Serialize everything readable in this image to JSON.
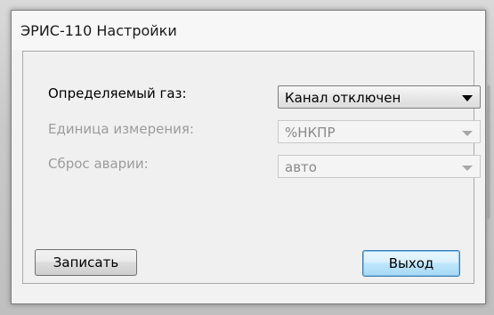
{
  "window": {
    "title": "ЭРИС-110 Настройки"
  },
  "settings": {
    "gas": {
      "label": "Определяемый газ:",
      "value": "Канал отключен",
      "enabled": true
    },
    "unit": {
      "label": "Единица измерения:",
      "value": "%НКПР",
      "enabled": false
    },
    "alarm_reset": {
      "label": "Сброс аварии:",
      "value": "авто",
      "enabled": false
    }
  },
  "buttons": {
    "write": "Записать",
    "exit": "Выход"
  },
  "icons": {
    "dropdown": "chevron-down-icon"
  },
  "colors": {
    "disabled_text": "#9c9c9c",
    "default_button_border": "#3c7fb1",
    "window_bg": "#f2f2f2"
  }
}
